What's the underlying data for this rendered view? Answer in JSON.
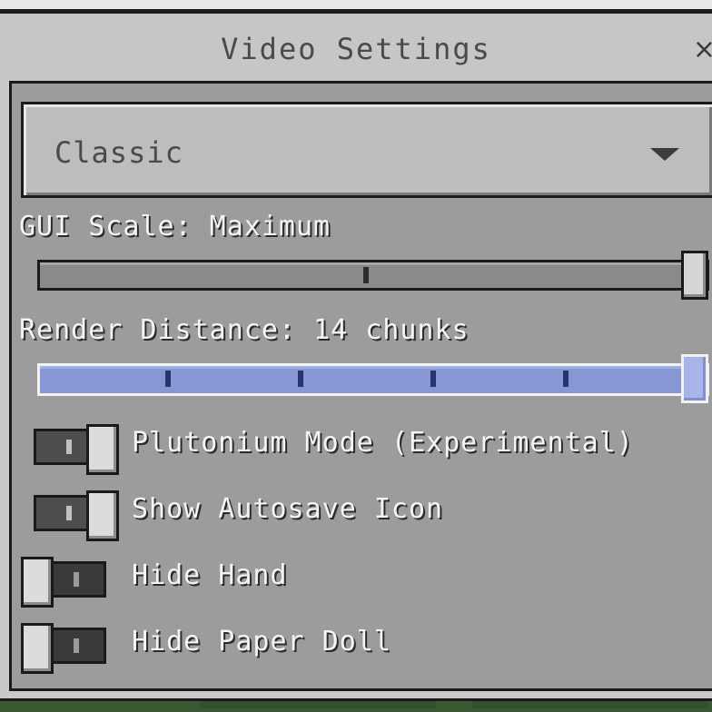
{
  "window": {
    "title": "Video Settings",
    "close_glyph": "×"
  },
  "clipped_label": "",
  "dropdown": {
    "selected": "Classic"
  },
  "gui_scale": {
    "label": "GUI Scale: Maximum",
    "level": 1.0
  },
  "render_distance": {
    "label": "Render Distance: 14 chunks",
    "level": 1.0
  },
  "toggles": [
    {
      "label": "Plutonium Mode (Experimental)",
      "on": true
    },
    {
      "label": "Show Autosave Icon",
      "on": true
    },
    {
      "label": "Hide Hand",
      "on": false
    },
    {
      "label": "Hide Paper Doll",
      "on": false
    }
  ],
  "colors": {
    "accent_slider": "#8797d4",
    "panel_gray": "#c6c6c6"
  },
  "icons": {
    "close": "close-icon",
    "dropdown": "chevron-down-icon"
  }
}
